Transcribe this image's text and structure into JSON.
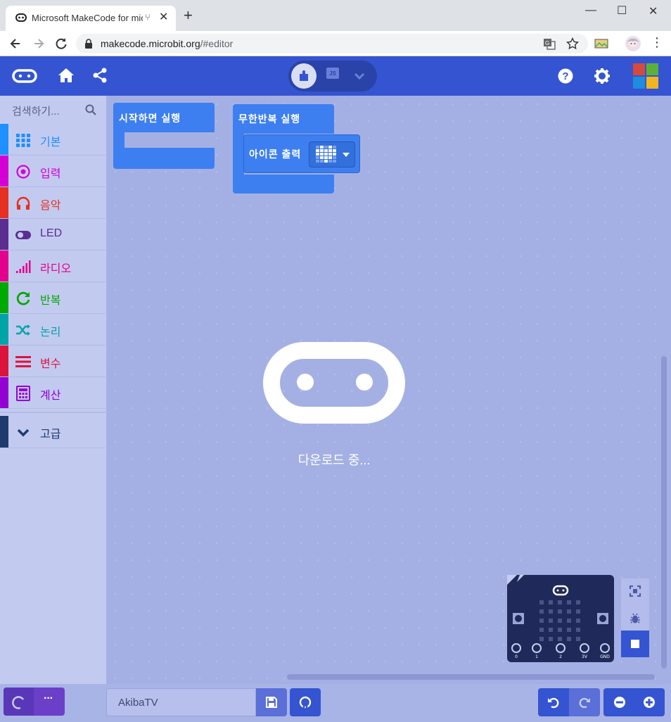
{
  "browser": {
    "tab_title": "Microsoft MakeCode for micro:bit",
    "url_host": "makecode.microbit.org",
    "url_path": "/#editor"
  },
  "toolbox": {
    "search_placeholder": "검색하기...",
    "categories": [
      {
        "label": "기본",
        "color": "#1e90ff",
        "icon": "grid-icon"
      },
      {
        "label": "입력",
        "color": "#d400d4",
        "icon": "target-icon"
      },
      {
        "label": "음악",
        "color": "#e63022",
        "icon": "headphones-icon"
      },
      {
        "label": "LED",
        "color": "#5c2d91",
        "icon": "toggle-icon"
      },
      {
        "label": "라디오",
        "color": "#e3008c",
        "icon": "signal-icon"
      },
      {
        "label": "반복",
        "color": "#00aa00",
        "icon": "refresh-icon"
      },
      {
        "label": "논리",
        "color": "#00a4a6",
        "icon": "shuffle-icon"
      },
      {
        "label": "변수",
        "color": "#dc143c",
        "icon": "lines-icon"
      },
      {
        "label": "계산",
        "color": "#9400d3",
        "icon": "calculator-icon"
      }
    ],
    "advanced": {
      "label": "고급",
      "color": "#3c3c3c"
    }
  },
  "workspace": {
    "block_on_start": "시작하면 실행",
    "block_forever": "무한반복 실행",
    "block_show_icon": "아이콘 출력",
    "loading_text": "다운로드 중..."
  },
  "simulator": {
    "pins": [
      "0",
      "1",
      "2",
      "3V",
      "GND"
    ]
  },
  "bottom": {
    "project_name": "AkibaTV"
  }
}
